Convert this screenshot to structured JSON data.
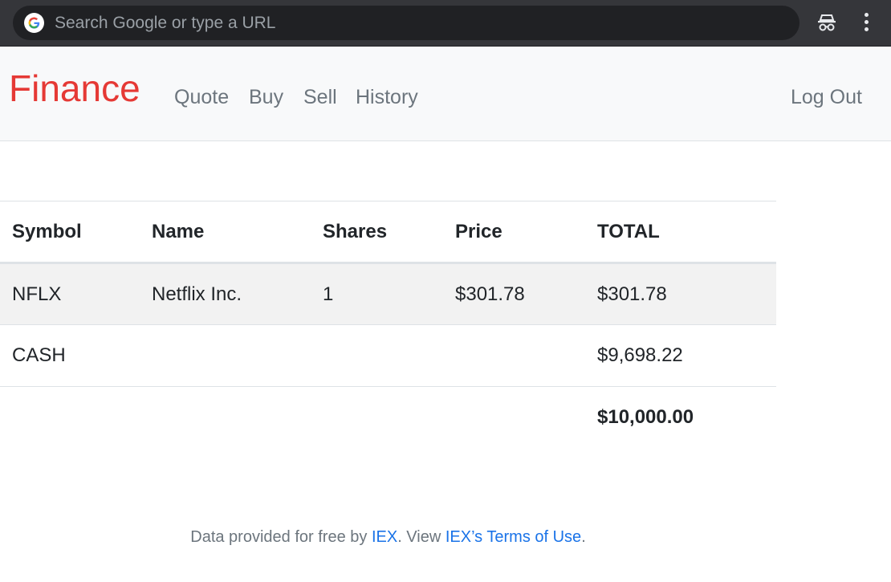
{
  "browser": {
    "omnibox_placeholder": "Search Google or type a URL",
    "icons": {
      "google": "google-g-icon",
      "incognito": "incognito-icon",
      "menu": "kebab-menu-icon"
    }
  },
  "navbar": {
    "brand": "Finance",
    "links": [
      "Quote",
      "Buy",
      "Sell",
      "History"
    ],
    "logout": "Log Out",
    "brand_color": "#e53935",
    "link_color": "#6c757d"
  },
  "table": {
    "headers": [
      "Symbol",
      "Name",
      "Shares",
      "Price",
      "TOTAL"
    ],
    "rows": [
      [
        "NFLX",
        "Netflix Inc.",
        "1",
        "$301.78",
        "$301.78"
      ],
      [
        "CASH",
        "",
        "",
        "",
        "$9,698.22"
      ]
    ],
    "grand_total": "$10,000.00"
  },
  "footer": {
    "prefix": "Data provided for free by ",
    "iex_link": "IEX",
    "middle": ". View ",
    "terms_link": "IEX’s Terms of Use",
    "suffix": ".",
    "link_color": "#1a73e8"
  }
}
